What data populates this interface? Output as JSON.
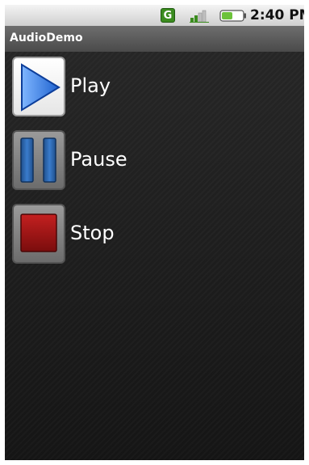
{
  "status_bar": {
    "network_badge": "G",
    "time": "2:40 PM",
    "icons": [
      "network-type-icon",
      "signal-strength-icon",
      "battery-icon"
    ]
  },
  "app": {
    "title": "AudioDemo"
  },
  "controls": [
    {
      "id": "play",
      "label": "Play",
      "icon": "play-icon"
    },
    {
      "id": "pause",
      "label": "Pause",
      "icon": "pause-icon"
    },
    {
      "id": "stop",
      "label": "Stop",
      "icon": "stop-icon"
    }
  ],
  "colors": {
    "play_blue": "#2f73d8",
    "pause_blue": "#2d63a8",
    "stop_red": "#a31616",
    "background": "#1c1c1c"
  }
}
